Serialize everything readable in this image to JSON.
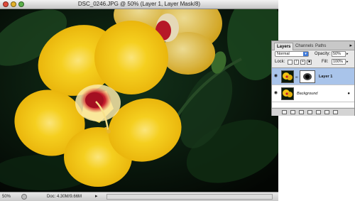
{
  "window": {
    "title": "DSC_0246.JPG @ 50% (Layer 1, Layer Mask/8)"
  },
  "status_bar": {
    "zoom": "50%",
    "doc_size": "Doc: 4.30M/9.66M"
  },
  "layers_panel": {
    "tabs": [
      "Layers",
      "Channels",
      "Paths"
    ],
    "blend_mode": "Normal",
    "opacity_label": "Opacity:",
    "opacity_value": "50%",
    "lock_label": "Lock:",
    "fill_label": "Fill:",
    "fill_value": "100%",
    "layers": [
      {
        "name": "Layer 1",
        "visible": true,
        "selected": true,
        "has_mask": true
      },
      {
        "name": "Background",
        "visible": true,
        "selected": false,
        "locked": true
      }
    ],
    "footer_icons": [
      "link-icon",
      "fx-icon",
      "mask-icon",
      "adjustment-icon",
      "folder-icon",
      "new-layer-icon",
      "trash-icon"
    ]
  },
  "colors": {
    "selection": "#a9c4ea",
    "petal": "#f3c414",
    "flower_center": "#c21a2a",
    "background": "#050a05"
  }
}
